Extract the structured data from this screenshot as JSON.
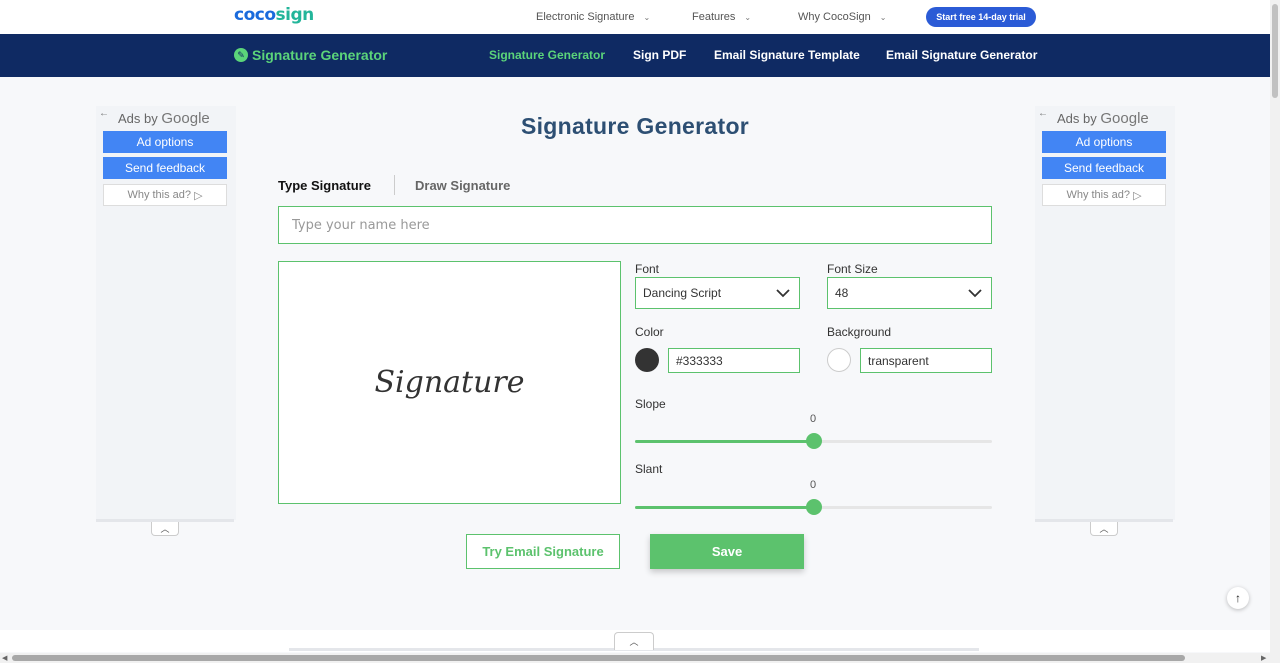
{
  "topbar": {
    "logo_part1": "coco",
    "logo_part2": "sign",
    "menu": [
      {
        "label": "Electronic Signature"
      },
      {
        "label": "Features"
      },
      {
        "label": "Why CocoSign"
      }
    ],
    "trial_button": "Start free 14-day trial"
  },
  "navbar": {
    "brand": "Signature Generator",
    "links": [
      {
        "label": "Signature Generator",
        "active": true
      },
      {
        "label": "Sign PDF"
      },
      {
        "label": "Email Signature Template"
      },
      {
        "label": "Email Signature Generator"
      }
    ]
  },
  "ads": {
    "ads_by": "Ads by",
    "google": "Google",
    "ad_options": "Ad options",
    "send_feedback": "Send feedback",
    "why_this_ad": "Why this ad?"
  },
  "main": {
    "title": "Signature Generator",
    "tabs": [
      {
        "label": "Type Signature",
        "active": true
      },
      {
        "label": "Draw Signature"
      }
    ],
    "name_input_placeholder": "Type your name here",
    "preview_text": "Signature",
    "font_label": "Font",
    "font_value": "Dancing Script",
    "font_size_label": "Font Size",
    "font_size_value": "48",
    "color_label": "Color",
    "color_value": "#333333",
    "background_label": "Background",
    "background_value": "transparent",
    "slope_label": "Slope",
    "slope_value": "0",
    "slant_label": "Slant",
    "slant_value": "0",
    "slider_fraction": 0.5,
    "try_email_button": "Try Email Signature",
    "save_button": "Save"
  },
  "colors": {
    "accent_green": "#5cc26d",
    "nav_bg": "#0f2a63",
    "title_blue": "#2d4f73",
    "google_blue": "#4285f4",
    "signature_color": "#333333"
  }
}
